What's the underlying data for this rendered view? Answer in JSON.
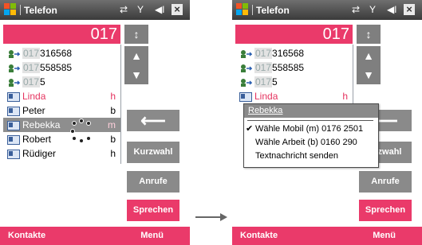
{
  "arrow_label": "",
  "left": {
    "title": "Telefon",
    "dial_value": "017",
    "contacts": [
      {
        "type": "call",
        "prefix": "017",
        "rest": "316568",
        "tag": ""
      },
      {
        "type": "call",
        "prefix": "017",
        "rest": "558585",
        "tag": ""
      },
      {
        "type": "call",
        "prefix": "017",
        "rest": "5",
        "tag": ""
      },
      {
        "type": "card",
        "prefix": "",
        "rest": "Linda",
        "tag": "h"
      },
      {
        "type": "card",
        "prefix": "",
        "rest": "Peter",
        "tag": "b"
      },
      {
        "type": "card",
        "prefix": "",
        "rest": "Rebekka",
        "tag": "m"
      },
      {
        "type": "card",
        "prefix": "",
        "rest": "Robert",
        "tag": "b"
      },
      {
        "type": "card",
        "prefix": "",
        "rest": "Rüdiger",
        "tag": "h"
      }
    ],
    "buttons": {
      "kurzwahl": "Kurzwahl",
      "anrufe": "Anrufe",
      "sprechen": "Sprechen"
    },
    "softkeys": {
      "left": "Kontakte",
      "right": "Menü"
    }
  },
  "right": {
    "title": "Telefon",
    "dial_value": "017",
    "contacts": [
      {
        "prefix": "017",
        "rest": "316568"
      },
      {
        "prefix": "017",
        "rest": "558585"
      },
      {
        "prefix": "017",
        "rest": "5"
      },
      {
        "rest": "Linda",
        "tag": "h"
      }
    ],
    "context_menu": {
      "header": "Rebekka",
      "items": [
        "Wähle Mobil (m) 0176 2501",
        "Wähle Arbeit (b) 0160 290",
        "Textnachricht senden"
      ],
      "checked_index": 0
    },
    "buttons": {
      "kurzwahl": "urzwahl",
      "anrufe": "Anrufe",
      "sprechen": "Sprechen"
    },
    "softkeys": {
      "left": "Kontakte",
      "right": "Menü"
    }
  }
}
